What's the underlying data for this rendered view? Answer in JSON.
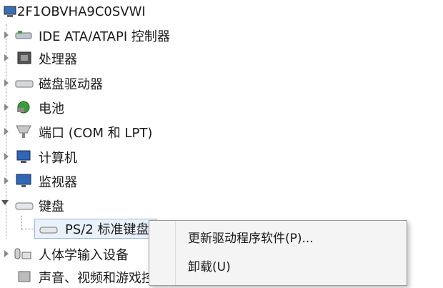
{
  "window": {
    "computer_name": "2F1OBVHA9C0SVWI"
  },
  "device_tree": {
    "items": [
      {
        "label": "IDE ATA/ATAPI 控制器",
        "icon": "ide-controller-icon"
      },
      {
        "label": "处理器",
        "icon": "processor-icon"
      },
      {
        "label": "磁盘驱动器",
        "icon": "disk-drive-icon"
      },
      {
        "label": "电池",
        "icon": "battery-icon"
      },
      {
        "label": "端口 (COM 和 LPT)",
        "icon": "port-icon"
      },
      {
        "label": "计算机",
        "icon": "computer-icon"
      },
      {
        "label": "监视器",
        "icon": "monitor-icon"
      },
      {
        "label": "键盘",
        "icon": "keyboard-icon"
      },
      {
        "label": "人体学输入设备",
        "icon": "hid-icon"
      }
    ],
    "keyboard_child": {
      "label": "PS/2 标准键盘",
      "icon": "keyboard-icon"
    },
    "next_partial": "声音、视频和游戏控制器"
  },
  "context_menu": {
    "items": [
      {
        "label": "更新驱动程序软件(P)..."
      },
      {
        "label": "卸载(U)"
      }
    ]
  }
}
